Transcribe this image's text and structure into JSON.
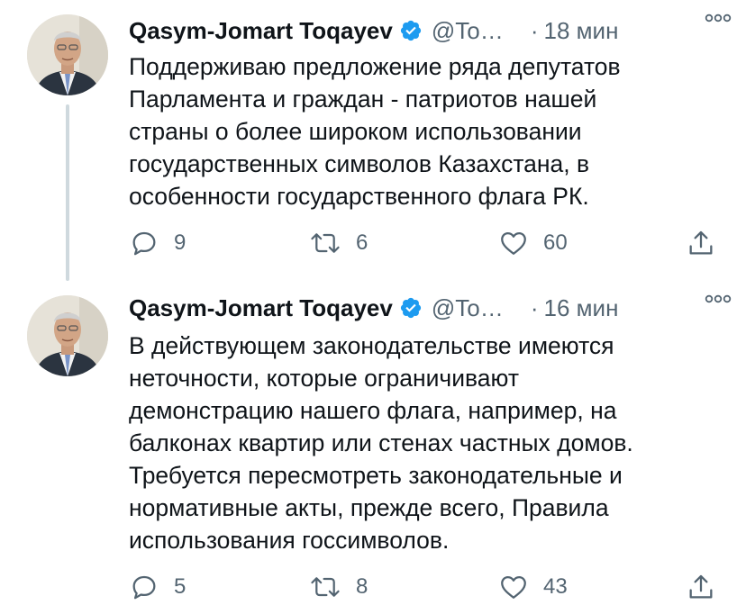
{
  "tweets": [
    {
      "author": {
        "display_name": "Qasym-Jomart Toqayev",
        "handle": "@To…",
        "verified": true
      },
      "separator": "·",
      "time": "18 мин",
      "text": "Поддерживаю предложение ряда депутатов\nПарламента и граждан - патриотов нашей\nстраны о более широком использовании\nгосударственных символов Казахстана, в\nособенности государственного флага РК.",
      "stats": {
        "replies": "9",
        "retweets": "6",
        "likes": "60"
      }
    },
    {
      "author": {
        "display_name": "Qasym-Jomart Toqayev",
        "handle": "@To…",
        "verified": true
      },
      "separator": "·",
      "time": "16 мин",
      "text": "В действующем законодательстве имеются\nнеточности, которые ограничивают\nдемонстрацию нашего флага, например, на\nбалконах квартир или стенах частных домов.\nТребуется пересмотреть законодательные и\nнормативные акты, прежде всего, Правила\nиспользования госсимволов.",
      "stats": {
        "replies": "5",
        "retweets": "8",
        "likes": "43"
      }
    }
  ],
  "icons": {
    "verified": "verified-badge-icon",
    "more": "more-options-icon",
    "reply": "reply-icon",
    "retweet": "retweet-icon",
    "like": "heart-icon",
    "share": "share-icon"
  },
  "colors": {
    "verified_badge": "#1d9bf0",
    "secondary_text": "#536471",
    "primary_text": "#0f1419",
    "thread_line": "#cfd9de"
  }
}
